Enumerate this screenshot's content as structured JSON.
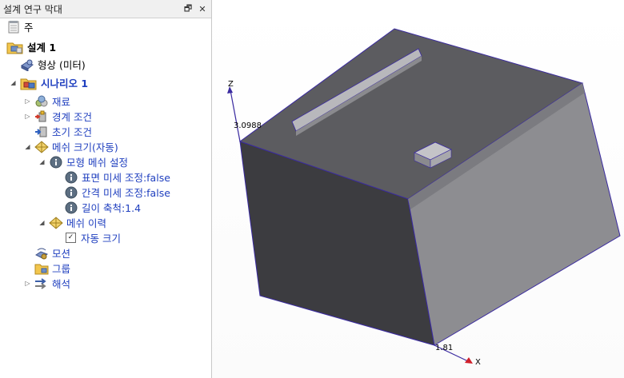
{
  "panel": {
    "title": "설계 연구 막대",
    "restore_glyph": "🗗",
    "close_glyph": "✕"
  },
  "tree": {
    "notes": "주",
    "study": "설계 1",
    "geometry": "형상 (미터)",
    "scenario": "시나리오 1",
    "materials": "재료",
    "boundary": "경계 조건",
    "initial": "초기 조건",
    "mesh_size": "메쉬 크기(자동)",
    "model_mesh": "모형 메쉬 설정",
    "surface_refine": "표면 미세 조정:false",
    "gap_refine": "간격 미세 조정:false",
    "length_scale": "길이 축척:1.4",
    "mesh_history": "메쉬 이력",
    "auto_size": "자동 크기",
    "auto_size_checked": true,
    "motion": "모션",
    "groups": "그룹",
    "analysis": "해석"
  },
  "viewport": {
    "z_axis": "Z",
    "x_axis": "X",
    "z_value": "3.0988",
    "x_value": "1.81",
    "axis_color": "#3a2aa0",
    "x_arrow_color": "#d0202a"
  }
}
